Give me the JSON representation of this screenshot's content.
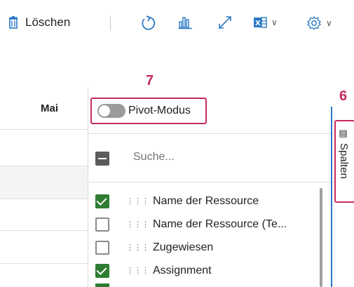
{
  "toolbar": {
    "delete_label": "Löschen",
    "icons": [
      "trash-icon",
      "refresh-icon",
      "chart-icon",
      "expand-icon",
      "excel-icon",
      "settings-icon"
    ]
  },
  "grid": {
    "column_header": "Mai"
  },
  "panel": {
    "pivot_label": "Pivot-Modus",
    "pivot_enabled": false,
    "search_placeholder": "Suche...",
    "columns": [
      {
        "label": "Name der Ressource",
        "checked": true
      },
      {
        "label": "Name der Ressource (Te...",
        "checked": false
      },
      {
        "label": "Zugewiesen",
        "checked": false
      },
      {
        "label": "Assignment",
        "checked": true
      }
    ]
  },
  "side_tab": {
    "label": "Spalten"
  },
  "annotations": {
    "pivot_marker": "7",
    "tab_marker": "6"
  },
  "colors": {
    "accent_red": "#c62b5a",
    "check_green": "#2e7d32",
    "tab_blue": "#2b78c5"
  }
}
